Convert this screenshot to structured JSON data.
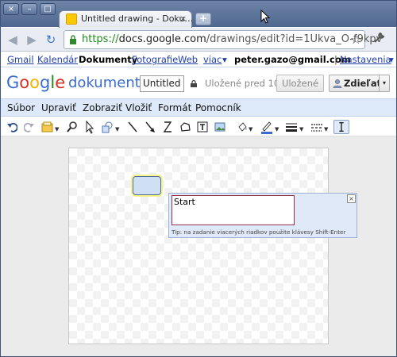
{
  "window": {
    "tab_title": "Untitled drawing - Doku…",
    "tab_close": "×",
    "new_tab": "+",
    "btn_close": "×",
    "btn_min": "–",
    "btn_max": "□"
  },
  "toolbar": {
    "url_scheme": "https://",
    "url_domain": "docs.google.com",
    "url_path": "/drawings/edit?id=1Ukva_O-f9kpv",
    "star": "☆",
    "wrench": "🔧"
  },
  "gbar": {
    "links": [
      "Gmail",
      "Kalendár",
      "Dokumenty",
      "Fotografie",
      "Web",
      "viac"
    ],
    "more_arrow": "▾",
    "user": "peter.gazo@gmail.com",
    "separator": "|",
    "settings": "Nastavenia",
    "settings_arrow": "▾"
  },
  "header": {
    "logo_letters": [
      "G",
      "o",
      "o",
      "g",
      "l",
      "e"
    ],
    "product": "dokumenty",
    "doc_title": "Untitled d",
    "status": "Uložené pred 10",
    "save_label": "Uložené",
    "share_label": "Zdieľať",
    "share_arrow": "▾"
  },
  "menubar": {
    "items": [
      "Súbor",
      "Upraviť",
      "Zobraziť",
      "Vložiť",
      "Formát",
      "Pomocník"
    ]
  },
  "drawbar": {
    "icons": [
      "undo-icon",
      "redo-icon",
      "insert-shape-icon",
      "zoom-icon",
      "select-icon",
      "shapes-icon",
      "line-icon",
      "arrow-icon",
      "curve-icon",
      "polygon-icon",
      "textbox-icon",
      "image-icon",
      "fill-color-icon",
      "line-color-icon",
      "line-weight-icon",
      "line-dash-icon",
      "text-cursor-icon"
    ]
  },
  "canvas": {
    "text_value": "Start",
    "tip": "Tip: na zadanie viacerých riadkov použite klávesy Shift-Enter",
    "close": "×"
  },
  "colors": {
    "accent": "#3a6ccf",
    "menubar": "#dde8f8",
    "url_green": "#1a8b1a",
    "shape_fill": "#cfe0f5"
  }
}
